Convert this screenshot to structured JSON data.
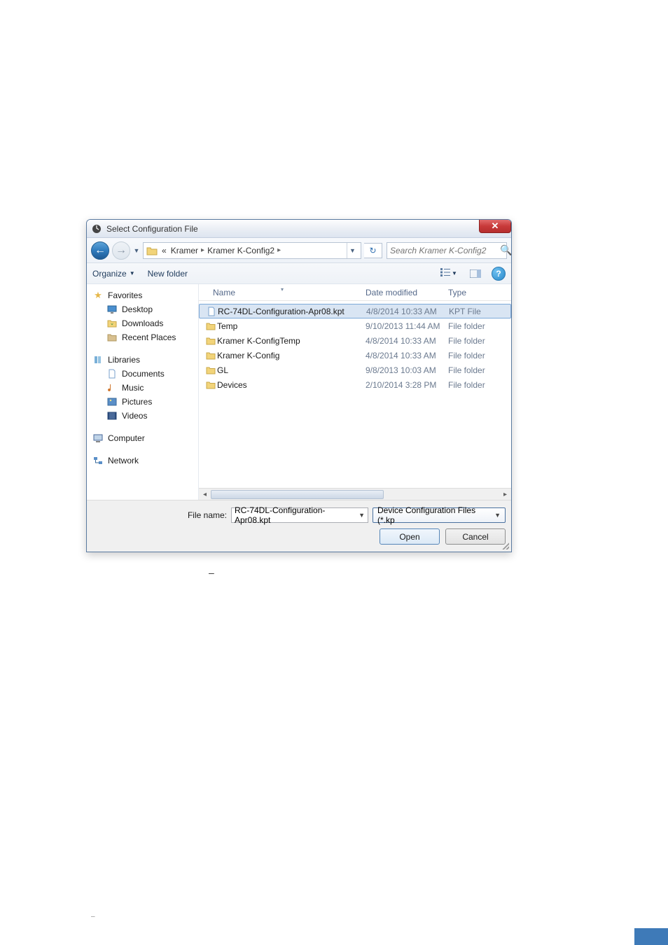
{
  "dialog": {
    "title": "Select Configuration File",
    "breadcrumb": {
      "prefix": "«",
      "items": [
        "Kramer",
        "Kramer K-Config2"
      ]
    },
    "search_placeholder": "Search Kramer K-Config2",
    "toolbar": {
      "organize": "Organize",
      "new_folder": "New folder"
    },
    "nav_pane": {
      "favorites": {
        "header": "Favorites",
        "items": [
          "Desktop",
          "Downloads",
          "Recent Places"
        ]
      },
      "libraries": {
        "header": "Libraries",
        "items": [
          "Documents",
          "Music",
          "Pictures",
          "Videos"
        ]
      },
      "computer": "Computer",
      "network": "Network"
    },
    "columns": {
      "name": "Name",
      "date": "Date modified",
      "type": "Type"
    },
    "files": [
      {
        "name": "RC-74DL-Configuration-Apr08.kpt",
        "date": "4/8/2014 10:33 AM",
        "type": "KPT File",
        "icon": "file",
        "selected": true
      },
      {
        "name": "Temp",
        "date": "9/10/2013 11:44 AM",
        "type": "File folder",
        "icon": "folder",
        "selected": false
      },
      {
        "name": "Kramer K-ConfigTemp",
        "date": "4/8/2014 10:33 AM",
        "type": "File folder",
        "icon": "folder",
        "selected": false
      },
      {
        "name": "Kramer K-Config",
        "date": "4/8/2014 10:33 AM",
        "type": "File folder",
        "icon": "folder",
        "selected": false
      },
      {
        "name": "GL",
        "date": "9/8/2013 10:03 AM",
        "type": "File folder",
        "icon": "folder",
        "selected": false
      },
      {
        "name": "Devices",
        "date": "2/10/2014 3:28 PM",
        "type": "File folder",
        "icon": "folder",
        "selected": false
      }
    ],
    "bottom": {
      "filename_label": "File name:",
      "filename_value": "RC-74DL-Configuration-Apr08.kpt",
      "filter_value": "Device Configuration Files (*.kp",
      "open": "Open",
      "cancel": "Cancel"
    }
  },
  "caption_dash": "–",
  "doc_mark": "–"
}
